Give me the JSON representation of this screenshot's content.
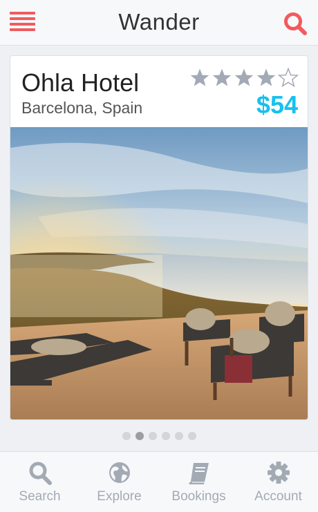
{
  "header": {
    "title": "Wander",
    "menu_icon": "hamburger-menu-icon",
    "search_icon": "search-icon"
  },
  "hotel": {
    "name": "Ohla Hotel",
    "location": "Barcelona, Spain",
    "price": "$54",
    "rating": 4,
    "rating_max": 5,
    "photo_description_icon": "hotel-photo"
  },
  "carousel": {
    "pages": 6,
    "current": 2
  },
  "tabs": [
    {
      "label": "Search",
      "icon": "search-icon"
    },
    {
      "label": "Explore",
      "icon": "globe-icon"
    },
    {
      "label": "Bookings",
      "icon": "book-icon"
    },
    {
      "label": "Account",
      "icon": "gear-icon"
    }
  ],
  "colors": {
    "accent_red": "#f25a5f",
    "price_blue": "#16c1ee",
    "star_filled": "#a3aab5",
    "tab_gray": "#a3aab3"
  }
}
